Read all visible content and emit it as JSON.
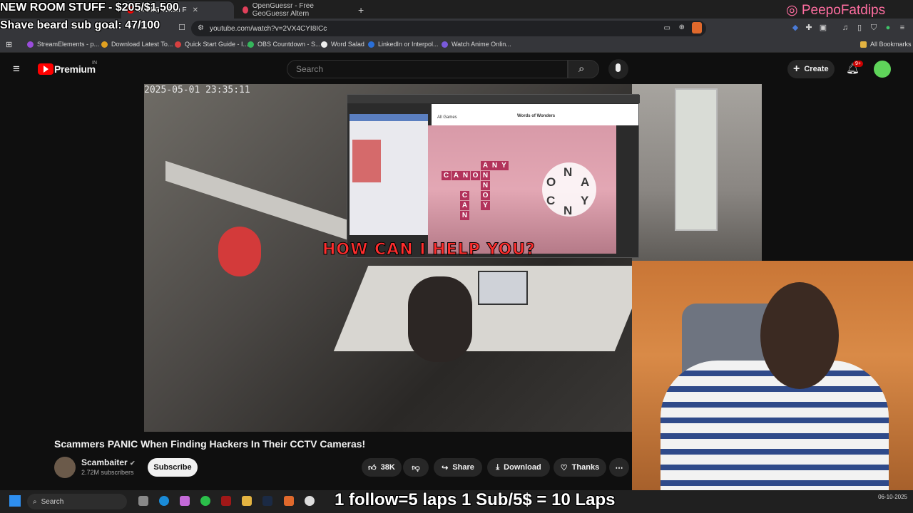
{
  "browser": {
    "tabs": [
      {
        "title": "PANIC When F",
        "active": true
      },
      {
        "title": "OpenGuessr - Free GeoGuessr Altern",
        "active": false
      }
    ],
    "new_tab": "+",
    "url": "youtube.com/watch?v=2VX4CYI8ICc",
    "bookmarks": [
      "StreamElements - p...",
      "Download Latest To...",
      "Quick Start Guide - I...",
      "OBS Countdown - S...",
      "Word Salad",
      "LinkedIn or Interpol...",
      "Watch Anime Onlin..."
    ],
    "all_bookmarks": "All Bookmarks"
  },
  "youtube": {
    "brand": "Premium",
    "region": "IN",
    "search_placeholder": "Search",
    "create_label": "Create",
    "notif_count": "9+"
  },
  "video": {
    "timestamp": "2025-05-01 23:35:11",
    "caption": "HOW CAN I HELP YOU?",
    "game": {
      "header": "Words of Wonders",
      "all_games": "All Games",
      "words": [
        "ANY",
        "CANON",
        "CAN",
        "NOON"
      ],
      "wheel_letters": [
        "N",
        "O",
        "A",
        "C",
        "Y",
        "N"
      ]
    },
    "title": "Scammers PANIC When Finding Hackers In Their CCTV Cameras!",
    "channel": "Scambaiter",
    "subscribers": "2.72M subscribers",
    "subscribe_label": "Subscribe",
    "likes": "38K",
    "share_label": "Share",
    "download_label": "Download",
    "thanks_label": "Thanks"
  },
  "overlays": {
    "goal_room": "NEW ROOM STUFF - $205/$1,500",
    "goal_beard": "Shave beard sub goal: 47/100",
    "instagram": "PeepoFatdips",
    "laps": "1 follow=5 laps 1 Sub/5$ = 10 Laps"
  },
  "taskbar": {
    "search": "Search",
    "date": "06-10-2025"
  },
  "colors": {
    "youtube_red": "#ff0000",
    "caption_red": "#ff2d2d",
    "instagram_pink": "#ff6ea0"
  }
}
